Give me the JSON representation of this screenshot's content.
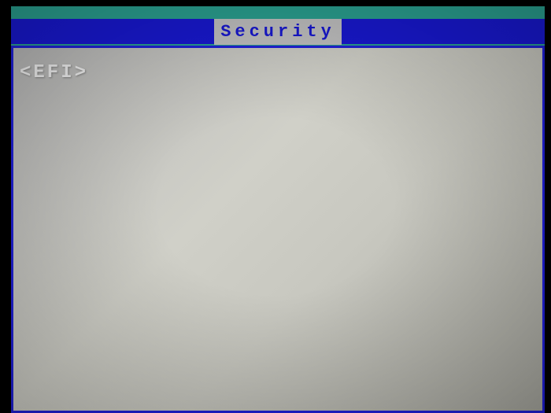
{
  "tab": {
    "active_label": "Security"
  },
  "content": {
    "items": [
      {
        "label": "<EFI>"
      }
    ]
  },
  "colors": {
    "menu_bg": "#1818d0",
    "tab_bg": "#c0c0c0",
    "tab_fg": "#1818d0",
    "panel_bg": "#c0c0c0",
    "border": "#2020d8",
    "item_fg": "#f0f0f0",
    "frame_bg": "#2aa090"
  }
}
